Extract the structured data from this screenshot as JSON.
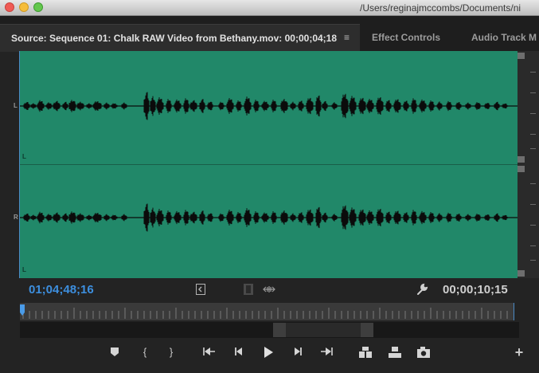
{
  "window": {
    "path": "/Users/reginajmccombs/Documents/ni"
  },
  "tabs": {
    "source": "Source: Sequence 01: Chalk RAW Video from Bethany.mov: 00;00;04;18",
    "menu_icon": "≡",
    "effect_controls": "Effect Controls",
    "audio_track": "Audio Track M"
  },
  "waveform": {
    "left_channel_label": "L",
    "left_channel_tag": "L",
    "right_channel_label": "R",
    "right_channel_tag": "L",
    "background_color": "#218869"
  },
  "timecodes": {
    "current": "01;04;48;16",
    "duration": "00;00;10;15"
  },
  "icons": {
    "wrench": "wrench-icon",
    "film": "film-icon",
    "audio_drag": "audio-drag-icon",
    "video_drag": "video-drag-icon"
  },
  "transport": {
    "add_marker": "add-marker-icon",
    "mark_in": "{",
    "mark_out": "}",
    "go_to_in": "go-to-in-icon",
    "step_back": "step-back-icon",
    "play": "play-icon",
    "step_forward": "step-forward-icon",
    "go_to_out": "go-to-out-icon",
    "insert": "insert-icon",
    "overwrite": "overwrite-icon",
    "export_frame": "camera-icon",
    "button_editor": "+"
  },
  "colors": {
    "accent_timecode": "#3d8fdf",
    "waveform_bg": "#218869"
  }
}
